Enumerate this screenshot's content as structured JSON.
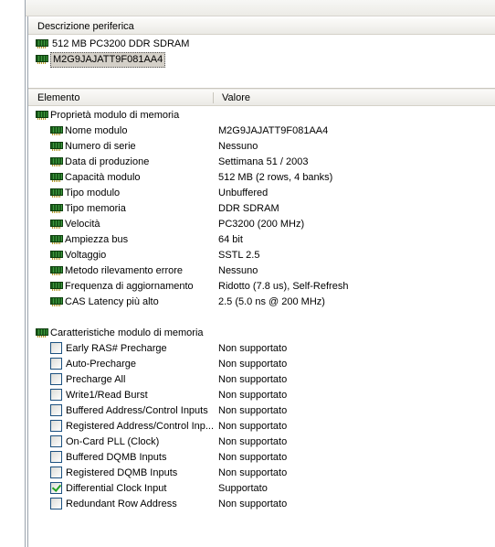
{
  "device_panel": {
    "header": "Descrizione periferica",
    "icon": "ram-module-icon",
    "devices": [
      {
        "label": "512 MB PC3200 DDR SDRAM",
        "selected": false
      },
      {
        "label": "M2G9JAJATT9F081AA4",
        "selected": true
      }
    ]
  },
  "details_panel": {
    "columns": {
      "element": "Elemento",
      "value": "Valore"
    },
    "groups": [
      {
        "title": "Proprietà modulo di memoria",
        "kind": "properties",
        "items": [
          {
            "name": "Nome modulo",
            "value": "M2G9JAJATT9F081AA4"
          },
          {
            "name": "Numero di serie",
            "value": "Nessuno"
          },
          {
            "name": "Data di produzione",
            "value": "Settimana 51 / 2003"
          },
          {
            "name": "Capacità modulo",
            "value": "512 MB (2 rows, 4 banks)"
          },
          {
            "name": "Tipo modulo",
            "value": "Unbuffered"
          },
          {
            "name": "Tipo memoria",
            "value": "DDR SDRAM"
          },
          {
            "name": "Velocità",
            "value": "PC3200 (200 MHz)"
          },
          {
            "name": "Ampiezza bus",
            "value": "64 bit"
          },
          {
            "name": "Voltaggio",
            "value": "SSTL 2.5"
          },
          {
            "name": "Metodo rilevamento errore",
            "value": "Nessuno"
          },
          {
            "name": "Frequenza di aggiornamento",
            "value": "Ridotto (7.8 us), Self-Refresh"
          },
          {
            "name": "CAS Latency più alto",
            "value": "2.5 (5.0 ns @ 200 MHz)"
          }
        ]
      },
      {
        "title": "Caratteristiche modulo di memoria",
        "kind": "features",
        "items": [
          {
            "name": "Early RAS# Precharge",
            "value": "Non supportato",
            "checked": false
          },
          {
            "name": "Auto-Precharge",
            "value": "Non supportato",
            "checked": false
          },
          {
            "name": "Precharge All",
            "value": "Non supportato",
            "checked": false
          },
          {
            "name": "Write1/Read Burst",
            "value": "Non supportato",
            "checked": false
          },
          {
            "name": "Buffered Address/Control Inputs",
            "value": "Non supportato",
            "checked": false
          },
          {
            "name": "Registered Address/Control Inp...",
            "value": "Non supportato",
            "checked": false
          },
          {
            "name": "On-Card PLL (Clock)",
            "value": "Non supportato",
            "checked": false
          },
          {
            "name": "Buffered DQMB Inputs",
            "value": "Non supportato",
            "checked": false
          },
          {
            "name": "Registered DQMB Inputs",
            "value": "Non supportato",
            "checked": false
          },
          {
            "name": "Differential Clock Input",
            "value": "Supportato",
            "checked": true
          },
          {
            "name": "Redundant Row Address",
            "value": "Non supportato",
            "checked": false
          }
        ]
      }
    ]
  }
}
